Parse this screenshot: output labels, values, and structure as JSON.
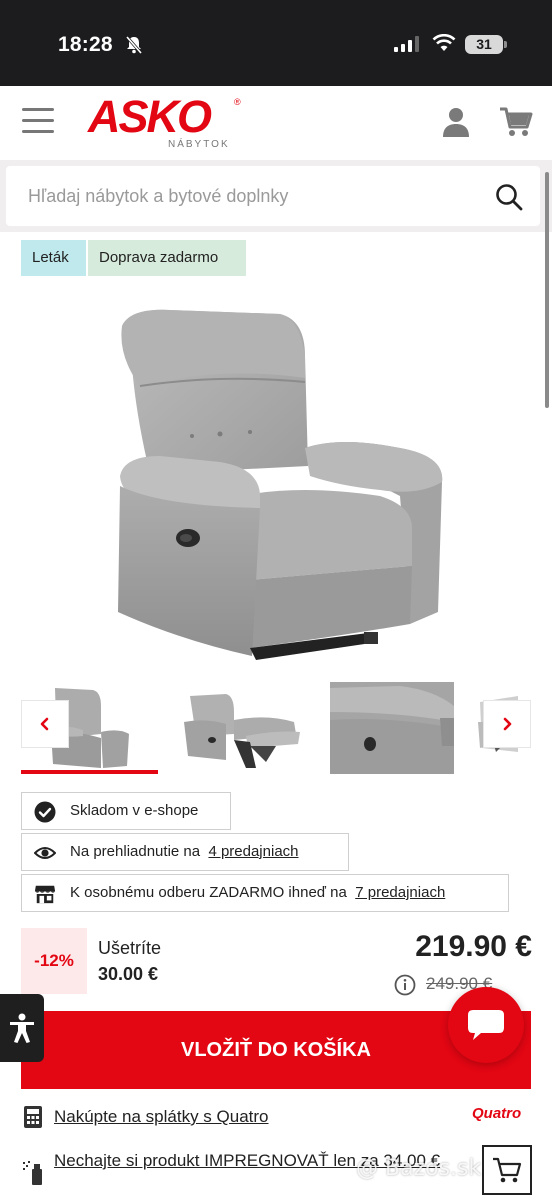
{
  "status_bar": {
    "time": "18:28",
    "battery": "31"
  },
  "brand": {
    "name": "ASKO",
    "tagline": "NÁBYTOK",
    "color": "#e30613"
  },
  "search": {
    "placeholder": "Hľadaj nábytok a bytové doplnky"
  },
  "badges": {
    "letak": "Leták",
    "doprava": "Doprava zadarmo"
  },
  "availability": {
    "stock": "Skladom v e-shope",
    "view_prefix": "Na prehliadnutie na",
    "view_link": "4 predajniach",
    "pickup_prefix": "K osobnému odberu ZADARMO ihneď na",
    "pickup_link": "7 predajniach"
  },
  "pricing": {
    "discount": "-12%",
    "save_label": "Ušetríte",
    "save_amount": "30.00 €",
    "price": "219.90 €",
    "old_price": "249.90 €"
  },
  "add_to_cart": "VLOŽIŤ DO KOŠÍKA",
  "links": {
    "quatro": "Nakúpte na splátky s Quatro",
    "quatro_logo": "Quatro",
    "impregnate": "Nechajte si produkt IMPREGNOVAŤ len za 34.00 €"
  },
  "watermark": "Bazos.sk",
  "icons": {
    "menu": "hamburger-icon",
    "user": "user-icon",
    "cart": "cart-icon",
    "search": "search-icon",
    "prev": "chevron-left-icon",
    "next": "chevron-right-icon",
    "stock": "check-circle-icon",
    "view": "eye-icon",
    "pickup": "store-icon",
    "info": "info-icon",
    "accessibility": "accessibility-icon",
    "chat": "chat-icon",
    "calculator": "calculator-icon",
    "spray": "spray-icon"
  }
}
